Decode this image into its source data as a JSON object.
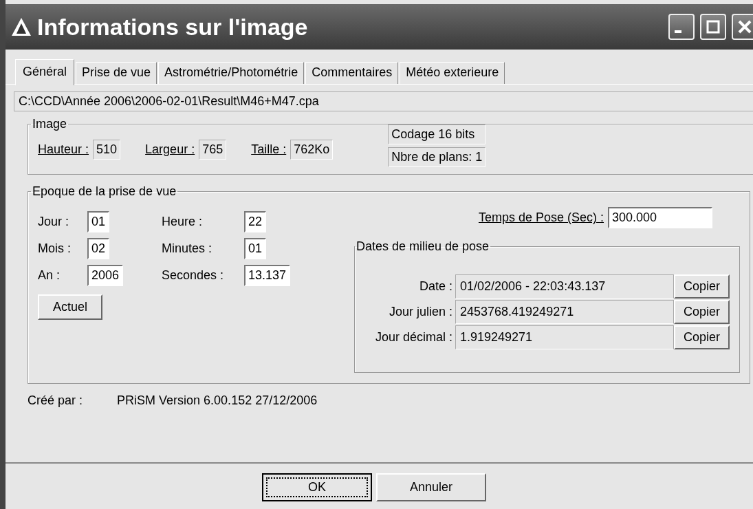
{
  "window": {
    "title": "Informations sur l'image"
  },
  "tabs": [
    {
      "label": "Général",
      "selected": true
    },
    {
      "label": "Prise de vue",
      "selected": false
    },
    {
      "label": "Astrométrie/Photométrie",
      "selected": false
    },
    {
      "label": "Commentaires",
      "selected": false
    },
    {
      "label": "Météo exterieure",
      "selected": false
    }
  ],
  "path": "C:\\CCD\\Année 2006\\2006-02-01\\Result\\M46+M47.cpa",
  "image_group": {
    "title": "Image",
    "fields": [
      {
        "label": "Hauteur :",
        "value": "510"
      },
      {
        "label": "Largeur :",
        "value": "765"
      },
      {
        "label": "Taille :",
        "value": "762Ko"
      }
    ],
    "info": [
      "Codage 16 bits",
      "Nbre de plans: 1"
    ]
  },
  "epoch_group": {
    "title": "Epoque de la prise de vue",
    "fields": [
      {
        "label": "Jour :",
        "value": "01"
      },
      {
        "label": "Heure :",
        "value": "22"
      },
      {
        "label": "Mois :",
        "value": "02"
      },
      {
        "label": "Minutes :",
        "value": "01"
      },
      {
        "label": "An :",
        "value": "2006"
      },
      {
        "label": "Secondes :",
        "value": "13.137"
      }
    ],
    "button": "Actuel",
    "exposure": {
      "label": "Temps de Pose (Sec) :",
      "value": "300.000"
    },
    "mid_dates": {
      "title": "Dates de milieu de pose",
      "rows": [
        {
          "label": "Date :",
          "value": "01/02/2006 - 22:03:43.137",
          "button": "Copier"
        },
        {
          "label": "Jour julien :",
          "value": "2453768.419249271",
          "button": "Copier"
        },
        {
          "label": "Jour décimal :",
          "value": "1.919249271",
          "button": "Copier"
        }
      ]
    }
  },
  "created_by": {
    "label": "Créé par :",
    "value": "PRiSM Version 6.00.152 27/12/2006"
  },
  "buttons": [
    {
      "label": "OK",
      "focused": true
    },
    {
      "label": "Annuler",
      "focused": false
    }
  ]
}
